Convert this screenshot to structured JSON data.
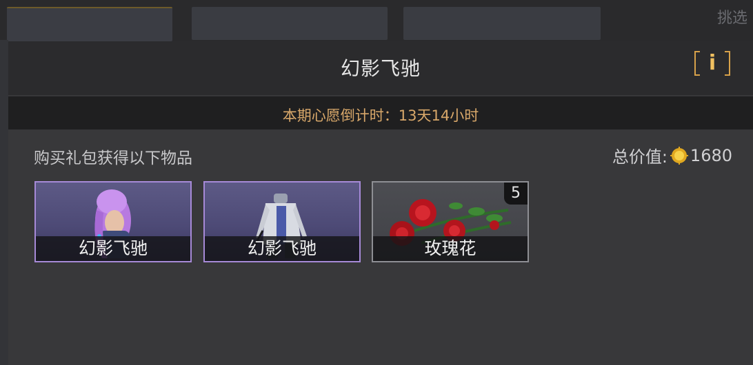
{
  "background": {
    "corner_text": "挑选"
  },
  "panel": {
    "title": "幻影飞驰",
    "info_icon": "info-icon",
    "countdown": "本期心愿倒计时：13天14小时",
    "section_label": "购买礼包获得以下物品",
    "total_value_label": "总价值:",
    "total_value_icon": "gold-coin-icon",
    "total_value_amount": "1680"
  },
  "items": [
    {
      "name": "幻影飞驰",
      "rarity_color": "#a78ad8",
      "icon": "purple-hair-character-icon",
      "quantity": null
    },
    {
      "name": "幻影飞驰",
      "rarity_color": "#a78ad8",
      "icon": "outfit-suit-icon",
      "quantity": null
    },
    {
      "name": "玫瑰花",
      "rarity_color": "#8e8f94",
      "icon": "red-rose-icon",
      "quantity": "5"
    }
  ],
  "colors": {
    "accent_gold": "#d8a24a",
    "countdown_text": "#d9a86a"
  }
}
